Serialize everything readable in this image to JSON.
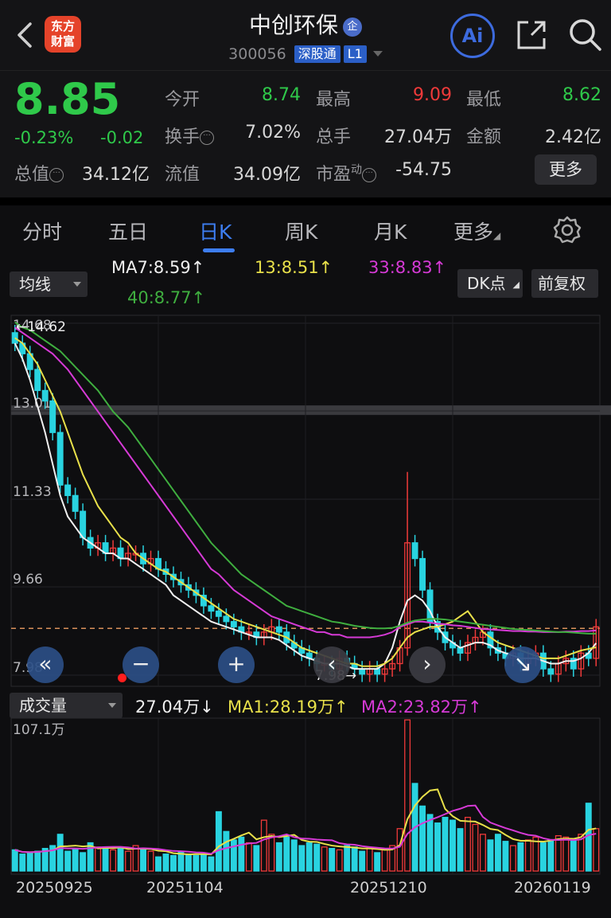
{
  "header": {
    "brand_text_line1": "东方",
    "brand_text_line2": "财富",
    "stock_name": "中创环保",
    "qi_badge": "企",
    "stock_code": "300056",
    "exchange_tag": "深股通",
    "level_tag": "L1",
    "ai_label": "Ai"
  },
  "quote": {
    "price": "8.85",
    "change_pct": "-0.23%",
    "change_abs": "-0.02",
    "rows": [
      {
        "label": "今开",
        "value": "8.74",
        "color": "#2fc94a"
      },
      {
        "label": "最高",
        "value": "9.09",
        "color": "#f03a3a"
      },
      {
        "label": "最低",
        "value": "8.62",
        "color": "#2fc94a"
      },
      {
        "label": "换手",
        "value": "7.02%",
        "color": "#d8d8d8"
      },
      {
        "label": "总手",
        "value": "27.04万",
        "color": "#d8d8d8"
      },
      {
        "label": "金额",
        "value": "2.42亿",
        "color": "#d8d8d8"
      },
      {
        "label": "总值",
        "value": "34.12亿",
        "color": "#d8d8d8"
      },
      {
        "label": "流值",
        "value": "34.09亿",
        "color": "#d8d8d8"
      },
      {
        "label": "市盈",
        "sup": "动",
        "value": "-54.75",
        "color": "#d8d8d8"
      }
    ],
    "more_label": "更多"
  },
  "tabs": {
    "items": [
      "分时",
      "五日",
      "日K",
      "周K",
      "月K",
      "更多"
    ],
    "active": "日K"
  },
  "chart_controls": {
    "ma_selector": "均线",
    "dk_label": "DK点",
    "adjust_label": "前复权",
    "volume_selector": "成交量"
  },
  "ma_legend": {
    "ma7": "MA7:8.59↑",
    "ma13": "13:8.51↑",
    "ma33": "33:8.83↑",
    "ma40": "40:8.77↑"
  },
  "vol_legend": {
    "current": "27.04万↓",
    "ma1": "MA1:28.19万↑",
    "ma2": "MA2:23.82万↑"
  },
  "colors": {
    "up": "#f03a3a",
    "down": "#29d3e0",
    "ma7": "#f0f0f0",
    "ma13": "#e8e04a",
    "ma33": "#d63ad6",
    "ma40": "#3fae3f",
    "accent": "#3d7ef2"
  },
  "chart_data": {
    "type": "candlestick",
    "price_axis_labels": [
      "14.68",
      "13.01",
      "11.33",
      "9.66",
      "7.98"
    ],
    "max_label": "←14.62",
    "min_label": "7.98→",
    "reference_price": 8.87,
    "volume_axis_label": "107.1万",
    "dates": [
      "20250925",
      "20251104",
      "20251210",
      "20260119"
    ],
    "close_series": [
      14.3,
      14.1,
      13.8,
      13.4,
      13.2,
      12.6,
      11.6,
      11.4,
      11.1,
      10.6,
      10.4,
      10.5,
      10.3,
      10.4,
      10.2,
      10.3,
      10.3,
      10.1,
      10.2,
      10.0,
      9.9,
      9.8,
      9.7,
      9.6,
      9.5,
      9.3,
      9.2,
      9.1,
      9.0,
      8.9,
      8.8,
      8.8,
      8.7,
      8.8,
      8.9,
      8.8,
      8.6,
      8.5,
      8.4,
      8.3,
      8.2,
      8.2,
      8.1,
      8.3,
      8.2,
      8.1,
      8.0,
      8.1,
      8.0,
      8.1,
      8.2,
      8.5,
      10.5,
      10.2,
      9.6,
      9.0,
      8.8,
      8.6,
      8.5,
      8.4,
      8.6,
      8.7,
      8.8,
      8.5,
      8.4,
      8.3,
      8.4,
      8.2,
      8.3,
      8.4,
      8.1,
      8.0,
      8.2,
      8.3,
      8.1,
      8.4,
      8.3,
      8.9
    ],
    "volume_series": [
      15,
      12,
      13,
      14,
      16,
      18,
      26,
      14,
      16,
      13,
      20,
      17,
      16,
      15,
      16,
      14,
      18,
      16,
      14,
      10,
      12,
      11,
      14,
      12,
      11,
      12,
      10,
      42,
      28,
      22,
      24,
      20,
      18,
      36,
      26,
      20,
      24,
      22,
      18,
      20,
      19,
      17,
      16,
      15,
      18,
      17,
      14,
      16,
      13,
      15,
      18,
      30,
      107,
      62,
      46,
      40,
      34,
      38,
      36,
      30,
      38,
      33,
      26,
      22,
      26,
      21,
      18,
      20,
      22,
      24,
      20,
      22,
      25,
      24,
      23,
      26,
      48,
      30
    ],
    "ma_lines": {
      "ma7": [
        14.3,
        14.0,
        13.6,
        13.1,
        12.6,
        12.0,
        11.4,
        11.0,
        10.8,
        10.6,
        10.5,
        10.4,
        10.3,
        10.3,
        10.2,
        10.2,
        10.1,
        10.0,
        9.9,
        9.8,
        9.7,
        9.5,
        9.4,
        9.3,
        9.2,
        9.1,
        9.0,
        8.95,
        8.9,
        8.85,
        8.8,
        8.75,
        8.7,
        8.7,
        8.7,
        8.65,
        8.55,
        8.45,
        8.35,
        8.3,
        8.25,
        8.2,
        8.2,
        8.2,
        8.15,
        8.1,
        8.1,
        8.1,
        8.1,
        8.2,
        8.5,
        9.0,
        9.4,
        9.5,
        9.4,
        9.2,
        8.9,
        8.7,
        8.6,
        8.5,
        8.55,
        8.6,
        8.6,
        8.55,
        8.45,
        8.4,
        8.35,
        8.3,
        8.3,
        8.3,
        8.25,
        8.2,
        8.2,
        8.25,
        8.25,
        8.3,
        8.4,
        8.59
      ],
      "ma13": [
        14.4,
        14.3,
        14.1,
        13.9,
        13.6,
        13.3,
        13.0,
        12.6,
        12.2,
        11.8,
        11.5,
        11.2,
        11.0,
        10.8,
        10.6,
        10.5,
        10.3,
        10.2,
        10.1,
        10.0,
        9.95,
        9.85,
        9.75,
        9.65,
        9.55,
        9.45,
        9.35,
        9.25,
        9.15,
        9.05,
        9.0,
        8.95,
        8.9,
        8.85,
        8.8,
        8.75,
        8.7,
        8.6,
        8.5,
        8.45,
        8.4,
        8.35,
        8.3,
        8.25,
        8.2,
        8.2,
        8.15,
        8.15,
        8.15,
        8.2,
        8.3,
        8.5,
        8.7,
        8.8,
        8.85,
        8.9,
        8.9,
        8.95,
        9.0,
        9.1,
        9.2,
        9.0,
        8.8,
        8.7,
        8.6,
        8.55,
        8.5,
        8.45,
        8.4,
        8.35,
        8.3,
        8.3,
        8.3,
        8.35,
        8.4,
        8.45,
        8.48,
        8.51
      ],
      "ma33": [
        14.6,
        14.5,
        14.4,
        14.3,
        14.2,
        14.1,
        13.95,
        13.8,
        13.6,
        13.4,
        13.2,
        13.0,
        12.8,
        12.6,
        12.4,
        12.2,
        12.0,
        11.8,
        11.6,
        11.4,
        11.2,
        11.0,
        10.8,
        10.6,
        10.4,
        10.2,
        10.0,
        9.9,
        9.75,
        9.6,
        9.5,
        9.4,
        9.3,
        9.2,
        9.1,
        9.05,
        9.0,
        8.95,
        8.9,
        8.85,
        8.8,
        8.8,
        8.75,
        8.75,
        8.7,
        8.7,
        8.7,
        8.7,
        8.72,
        8.75,
        8.8,
        8.9,
        8.95,
        9.0,
        9.0,
        8.98,
        8.96,
        8.95,
        8.93,
        8.92,
        8.9,
        8.88,
        8.86,
        8.85,
        8.84,
        8.83,
        8.82,
        8.82,
        8.81,
        8.81,
        8.8,
        8.8,
        8.8,
        8.81,
        8.81,
        8.82,
        8.82,
        8.83
      ],
      "ma40": [
        14.7,
        14.6,
        14.55,
        14.45,
        14.35,
        14.25,
        14.15,
        14.0,
        13.85,
        13.7,
        13.55,
        13.4,
        13.2,
        13.0,
        12.85,
        12.7,
        12.5,
        12.3,
        12.1,
        11.9,
        11.7,
        11.5,
        11.3,
        11.1,
        10.9,
        10.7,
        10.5,
        10.35,
        10.2,
        10.05,
        9.9,
        9.8,
        9.7,
        9.6,
        9.5,
        9.4,
        9.3,
        9.25,
        9.2,
        9.15,
        9.1,
        9.05,
        9.0,
        8.98,
        8.95,
        8.92,
        8.9,
        8.88,
        8.87,
        8.87,
        8.88,
        8.92,
        8.98,
        9.02,
        9.04,
        9.05,
        9.05,
        9.04,
        9.02,
        9.0,
        8.98,
        8.96,
        8.94,
        8.92,
        8.9,
        8.88,
        8.86,
        8.85,
        8.84,
        8.83,
        8.82,
        8.81,
        8.8,
        8.8,
        8.79,
        8.78,
        8.77,
        8.77
      ]
    }
  }
}
